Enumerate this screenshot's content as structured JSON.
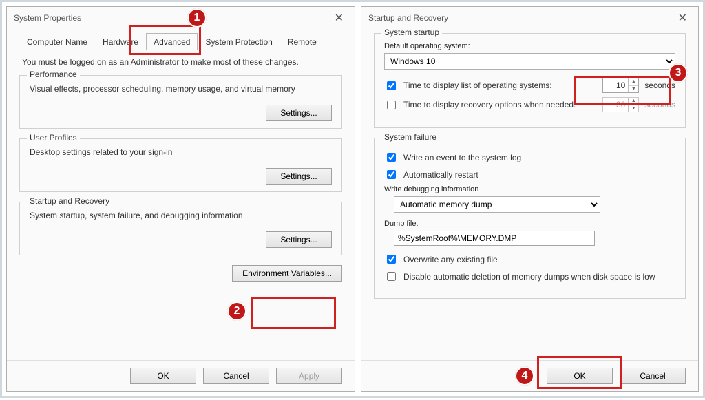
{
  "left": {
    "title": "System Properties",
    "tabs": {
      "computer_name": "Computer Name",
      "hardware": "Hardware",
      "advanced": "Advanced",
      "system_protection": "System Protection",
      "remote": "Remote"
    },
    "notice": "You must be logged on as an Administrator to make most of these changes.",
    "perf": {
      "legend": "Performance",
      "desc": "Visual effects, processor scheduling, memory usage, and virtual memory",
      "settings_btn": "Settings..."
    },
    "profiles": {
      "legend": "User Profiles",
      "desc": "Desktop settings related to your sign-in",
      "settings_btn": "Settings..."
    },
    "startup": {
      "legend": "Startup and Recovery",
      "desc": "System startup, system failure, and debugging information",
      "settings_btn": "Settings..."
    },
    "env_btn": "Environment Variables...",
    "ok": "OK",
    "cancel": "Cancel",
    "apply": "Apply"
  },
  "right": {
    "title": "Startup and Recovery",
    "startup_section": "System startup",
    "default_os_label": "Default operating system:",
    "default_os_value": "Windows 10",
    "chk_time_list": "Time to display list of operating systems:",
    "time_list_value": "10",
    "seconds": "seconds",
    "chk_time_recovery": "Time to display recovery options when needed:",
    "time_recovery_value": "30",
    "failure_section": "System failure",
    "chk_write_event": "Write an event to the system log",
    "chk_auto_restart": "Automatically restart",
    "write_debug_label": "Write debugging information",
    "debug_select_value": "Automatic memory dump",
    "dump_file_label": "Dump file:",
    "dump_file_value": "%SystemRoot%\\MEMORY.DMP",
    "chk_overwrite": "Overwrite any existing file",
    "chk_disable_delete": "Disable automatic deletion of memory dumps when disk space is low",
    "ok": "OK",
    "cancel": "Cancel"
  },
  "badges": {
    "one": "1",
    "two": "2",
    "three": "3",
    "four": "4"
  }
}
